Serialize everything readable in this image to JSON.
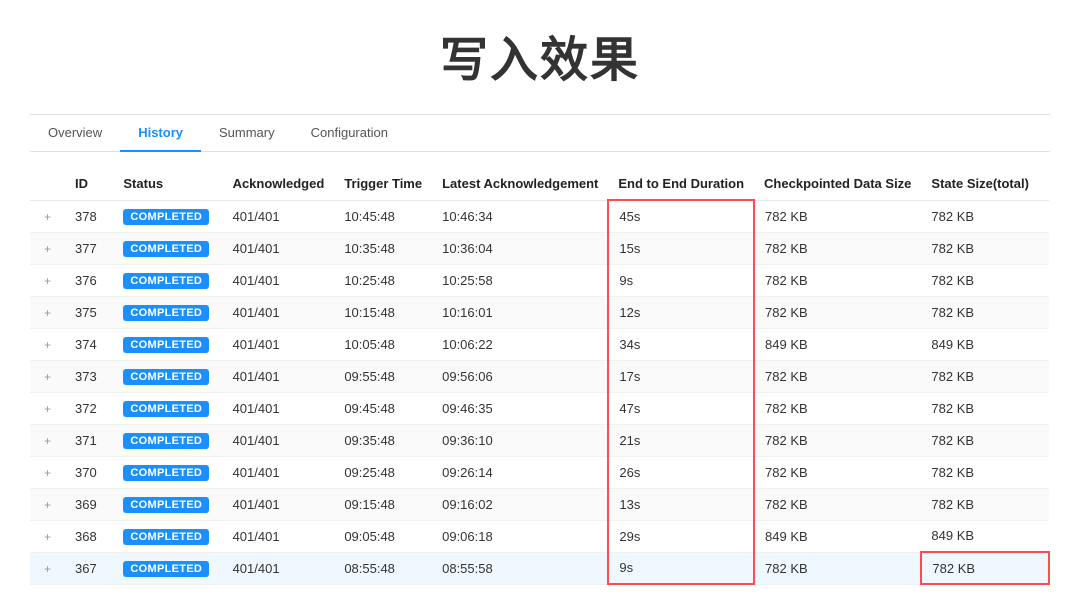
{
  "page": {
    "title": "写入效果"
  },
  "tabs": [
    {
      "label": "Overview",
      "active": false
    },
    {
      "label": "History",
      "active": true
    },
    {
      "label": "Summary",
      "active": false
    },
    {
      "label": "Configuration",
      "active": false
    }
  ],
  "table": {
    "columns": [
      "",
      "ID",
      "Status",
      "Acknowledged",
      "Trigger Time",
      "Latest Acknowledgement",
      "End to End Duration",
      "Checkpointed Data Size",
      "State Size(total)"
    ],
    "rows": [
      {
        "id": "378",
        "status": "COMPLETED",
        "acknowledged": "401/401",
        "trigger_time": "10:45:48",
        "latest_ack": "10:46:34",
        "e2e": "45s",
        "checkpoint": "782 KB",
        "state": "782 KB",
        "highlight": false
      },
      {
        "id": "377",
        "status": "COMPLETED",
        "acknowledged": "401/401",
        "trigger_time": "10:35:48",
        "latest_ack": "10:36:04",
        "e2e": "15s",
        "checkpoint": "782 KB",
        "state": "782 KB",
        "highlight": false
      },
      {
        "id": "376",
        "status": "COMPLETED",
        "acknowledged": "401/401",
        "trigger_time": "10:25:48",
        "latest_ack": "10:25:58",
        "e2e": "9s",
        "checkpoint": "782 KB",
        "state": "782 KB",
        "highlight": false
      },
      {
        "id": "375",
        "status": "COMPLETED",
        "acknowledged": "401/401",
        "trigger_time": "10:15:48",
        "latest_ack": "10:16:01",
        "e2e": "12s",
        "checkpoint": "782 KB",
        "state": "782 KB",
        "highlight": false
      },
      {
        "id": "374",
        "status": "COMPLETED",
        "acknowledged": "401/401",
        "trigger_time": "10:05:48",
        "latest_ack": "10:06:22",
        "e2e": "34s",
        "checkpoint": "849 KB",
        "state": "849 KB",
        "highlight": false
      },
      {
        "id": "373",
        "status": "COMPLETED",
        "acknowledged": "401/401",
        "trigger_time": "09:55:48",
        "latest_ack": "09:56:06",
        "e2e": "17s",
        "checkpoint": "782 KB",
        "state": "782 KB",
        "highlight": false
      },
      {
        "id": "372",
        "status": "COMPLETED",
        "acknowledged": "401/401",
        "trigger_time": "09:45:48",
        "latest_ack": "09:46:35",
        "e2e": "47s",
        "checkpoint": "782 KB",
        "state": "782 KB",
        "highlight": false
      },
      {
        "id": "371",
        "status": "COMPLETED",
        "acknowledged": "401/401",
        "trigger_time": "09:35:48",
        "latest_ack": "09:36:10",
        "e2e": "21s",
        "checkpoint": "782 KB",
        "state": "782 KB",
        "highlight": false
      },
      {
        "id": "370",
        "status": "COMPLETED",
        "acknowledged": "401/401",
        "trigger_time": "09:25:48",
        "latest_ack": "09:26:14",
        "e2e": "26s",
        "checkpoint": "782 KB",
        "state": "782 KB",
        "highlight": false
      },
      {
        "id": "369",
        "status": "COMPLETED",
        "acknowledged": "401/401",
        "trigger_time": "09:15:48",
        "latest_ack": "09:16:02",
        "e2e": "13s",
        "checkpoint": "782 KB",
        "state": "782 KB",
        "highlight": false
      },
      {
        "id": "368",
        "status": "COMPLETED",
        "acknowledged": "401/401",
        "trigger_time": "09:05:48",
        "latest_ack": "09:06:18",
        "e2e": "29s",
        "checkpoint": "849 KB",
        "state": "849 KB",
        "highlight": false
      },
      {
        "id": "367",
        "status": "COMPLETED",
        "acknowledged": "401/401",
        "trigger_time": "08:55:48",
        "latest_ack": "08:55:58",
        "e2e": "9s",
        "checkpoint": "782 KB",
        "state": "782 KB",
        "highlight": true
      }
    ]
  }
}
